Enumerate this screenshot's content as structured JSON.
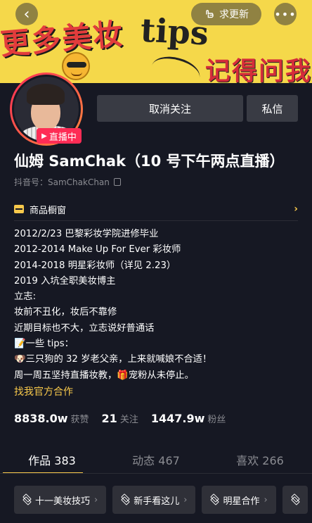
{
  "banner": {
    "text1": "更多美妆",
    "text2": "tips",
    "text3": "记得问我"
  },
  "top_bar": {
    "back_icon": "‹",
    "update_label": "求更新",
    "more_icon": "•••"
  },
  "profile": {
    "live_label": "直播中",
    "unfollow_label": "取消关注",
    "message_label": "私信",
    "name": "仙姆 SamChak（10 号下午两点直播）",
    "douyin_id": "抖音号：SamChakChan"
  },
  "shop": {
    "label": "商品橱窗",
    "chevron": "›"
  },
  "bio": {
    "lines": [
      "2012/2/23 巴黎彩妆学院进修毕业",
      "2012-2014 Make Up For Ever 彩妆师",
      "2014-2018 明星彩妆师（详见 2.23）",
      "2019 入坑全职美妆博主",
      "立志:",
      "妆前不丑化，妆后不靠修",
      "近期目标也不大，立志说好普通话",
      "📝一些 tips：",
      "🐶三只狗的 32 岁老父亲，上来就喊娘不合适！",
      "周一周五坚持直播妆教，🎁宠粉从未停止。"
    ],
    "link": "找我官方合作"
  },
  "stats": {
    "likes_value": "8838.0w",
    "likes_label": "获赞",
    "following_value": "21",
    "following_label": "关注",
    "fans_value": "1447.9w",
    "fans_label": "粉丝"
  },
  "tabs": [
    {
      "label": "作品 383"
    },
    {
      "label": "动态 467"
    },
    {
      "label": "喜欢 266"
    }
  ],
  "chips": [
    {
      "label": "十一美妆技巧",
      "arrow": "›"
    },
    {
      "label": "新手看这儿",
      "arrow": "›"
    },
    {
      "label": "明星合作",
      "arrow": "›"
    }
  ],
  "colors": {
    "background": "#161823",
    "accent_yellow": "#f7c84b",
    "live_red": "#fe2c55",
    "button_gray": "#393b44"
  }
}
